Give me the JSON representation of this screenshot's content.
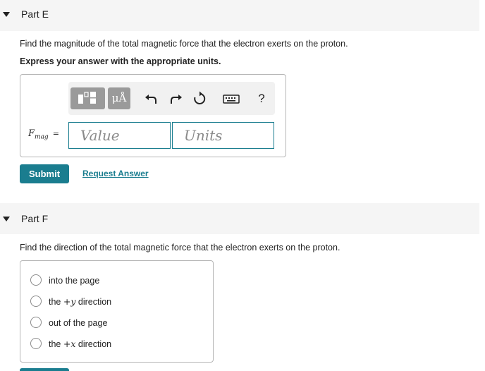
{
  "partE": {
    "header": "Part E",
    "question": "Find the magnitude of the total magnetic force that the electron exerts on the proton.",
    "instruction": "Express your answer with the appropriate units.",
    "toolbar": {
      "units_label": "μÅ",
      "help_label": "?"
    },
    "equation": {
      "variable": "F",
      "subscript": "mag",
      "equals": "="
    },
    "value_placeholder": "Value",
    "units_placeholder": "Units",
    "submit_label": "Submit",
    "request_label": "Request Answer"
  },
  "partF": {
    "header": "Part F",
    "question": "Find the direction of the total magnetic force that the electron exerts on the proton.",
    "options": [
      {
        "pre": "into the page",
        "math": "",
        "post": ""
      },
      {
        "pre": "the ",
        "math": "+y",
        "post": " direction"
      },
      {
        "pre": "out of the page",
        "math": "",
        "post": ""
      },
      {
        "pre": "the ",
        "math": "+x",
        "post": " direction"
      }
    ]
  },
  "colors": {
    "accent": "#1a7d8f",
    "toolbar_button": "#9a9a9a",
    "header_bg": "#f5f5f5"
  },
  "icons": [
    "caret-down-icon",
    "templates-icon",
    "undo-icon",
    "redo-icon",
    "reset-icon",
    "keyboard-icon",
    "help-icon"
  ]
}
